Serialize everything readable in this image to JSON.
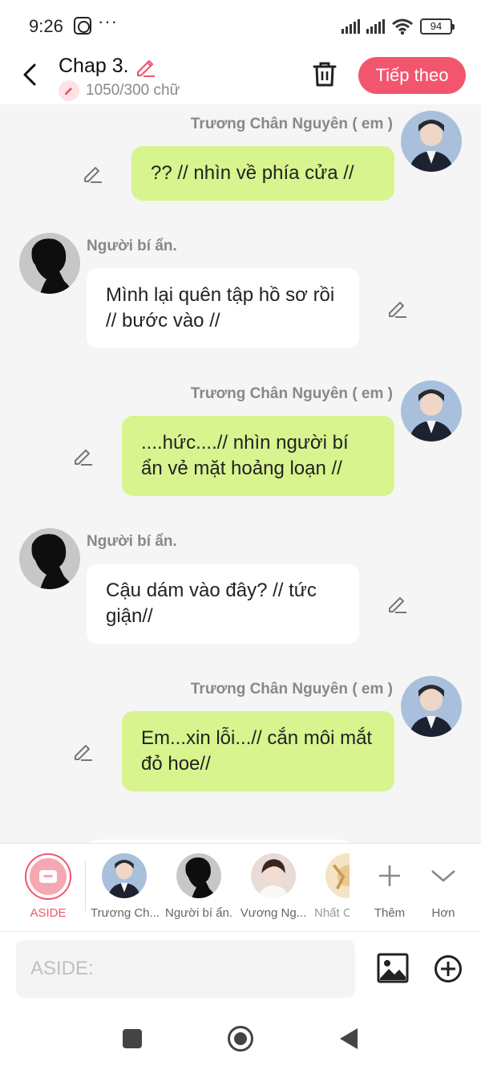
{
  "status_bar": {
    "time": "9:26",
    "dots": "···",
    "battery": "94"
  },
  "header": {
    "title": "Chap 3.",
    "word_count": "1050/300 chữ",
    "next_label": "Tiếp theo"
  },
  "messages": [
    {
      "side": "me",
      "sender": "Trương Chân Nguyên ( em )",
      "text": "?? // nhìn về phía cửa //"
    },
    {
      "side": "other",
      "sender": "Người bí ẩn.",
      "text": "Mình lại quên tập hồ sơ rồi // bước vào //"
    },
    {
      "side": "me",
      "sender": "Trương Chân Nguyên ( em )",
      "text": "....hức....// nhìn người bí ẩn vẻ mặt hoảng loạn //"
    },
    {
      "side": "other",
      "sender": "Người bí ẩn.",
      "text": "Cậu dám vào đây?  // tức giận//"
    },
    {
      "side": "me",
      "sender": "Trương Chân Nguyên ( em )",
      "text": "Em...xin lỗi...// cắn môi mắt đỏ hoe//"
    }
  ],
  "character_bar": {
    "aside_label": "ASIDE",
    "characters": [
      "Trương Ch...",
      "Người bí ẩn.",
      "Vương Ng...",
      "Nhất C"
    ],
    "add_label": "Thêm",
    "more_label": "Hơn"
  },
  "composer": {
    "placeholder": "ASIDE:"
  },
  "colors": {
    "accent": "#f2566f",
    "my_bubble": "#d7f48e",
    "other_bubble": "#ffffff",
    "background": "#f5f5f5"
  }
}
